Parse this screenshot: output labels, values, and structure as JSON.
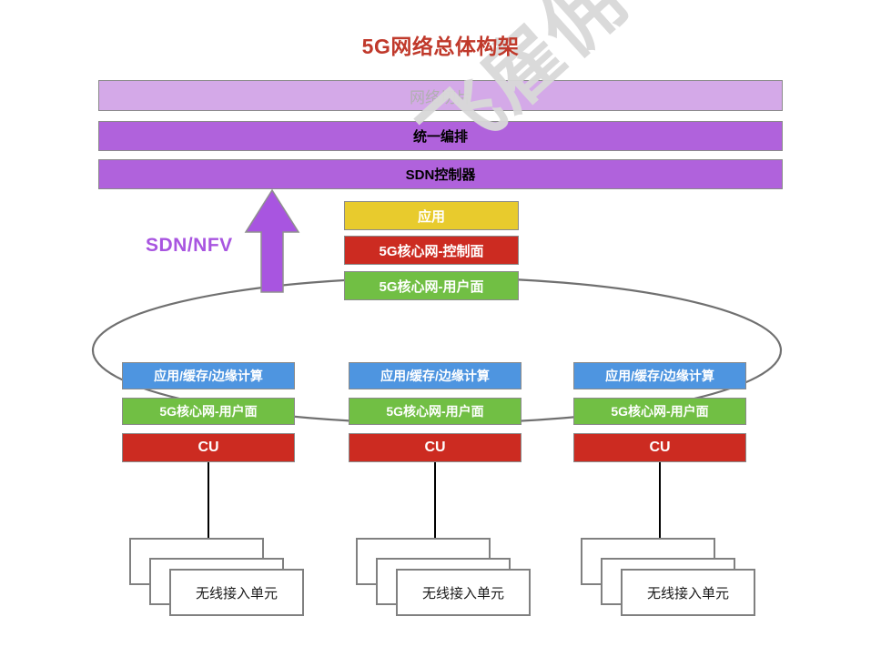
{
  "title": "5G网络总体构架",
  "watermark": "飞雇佣军",
  "colors": {
    "title": "#c0392b",
    "slice_bar": "#d4a9e8",
    "purple_bar": "#b062dc",
    "accent_purple": "#a855e0",
    "app_yellow": "#e8cb2d",
    "control_red": "#cc2b21",
    "user_green": "#71bf44",
    "edge_blue": "#4e95e0",
    "ring_gray": "#707070"
  },
  "top_bars": [
    {
      "id": "network-slicing",
      "label": "网络切片"
    },
    {
      "id": "unified-orchestration",
      "label": "统一编排"
    },
    {
      "id": "sdn-controller",
      "label": "SDN控制器"
    }
  ],
  "sdn_nfv": {
    "label": "SDN/NFV",
    "arrow_icon": "up-arrow-icon"
  },
  "core_stack": [
    {
      "id": "application",
      "label": "应用"
    },
    {
      "id": "5g-core-control-plane",
      "label": "5G核心网-控制面"
    },
    {
      "id": "5g-core-user-plane",
      "label": "5G核心网-用户面"
    }
  ],
  "columns": [
    {
      "id": "edge-site-1",
      "edge": "应用/缓存/边缘计算",
      "user_plane": "5G核心网-用户面",
      "cu": "CU",
      "access_unit": "无线接入单元"
    },
    {
      "id": "edge-site-2",
      "edge": "应用/缓存/边缘计算",
      "user_plane": "5G核心网-用户面",
      "cu": "CU",
      "access_unit": "无线接入单元"
    },
    {
      "id": "edge-site-3",
      "edge": "应用/缓存/边缘计算",
      "user_plane": "5G核心网-用户面",
      "cu": "CU",
      "access_unit": "无线接入单元"
    }
  ]
}
